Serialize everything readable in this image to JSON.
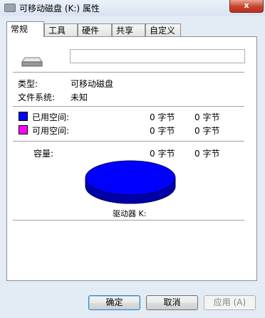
{
  "window": {
    "title": "可移动磁盘 (K:) 属性",
    "close_label": "x"
  },
  "tabs": [
    {
      "label": "常规"
    },
    {
      "label": "工具"
    },
    {
      "label": "硬件"
    },
    {
      "label": "共享"
    },
    {
      "label": "自定义"
    }
  ],
  "general": {
    "name_value": "",
    "type_label": "类型:",
    "type_value": "可移动磁盘",
    "fs_label": "文件系统:",
    "fs_value": "未知",
    "used_label": "已用空间:",
    "used_bytes": "0 字节",
    "used_size": "0 字节",
    "free_label": "可用空间:",
    "free_bytes": "0 字节",
    "free_size": "0 字节",
    "capacity_label": "容量:",
    "capacity_bytes": "0 字节",
    "capacity_size": "0 字节",
    "drive_label": "驱动器 K:"
  },
  "colors": {
    "used": "#0000ff",
    "free": "#ff00ff"
  },
  "buttons": {
    "ok": "确定",
    "cancel": "取消",
    "apply": "应用 (A)"
  }
}
